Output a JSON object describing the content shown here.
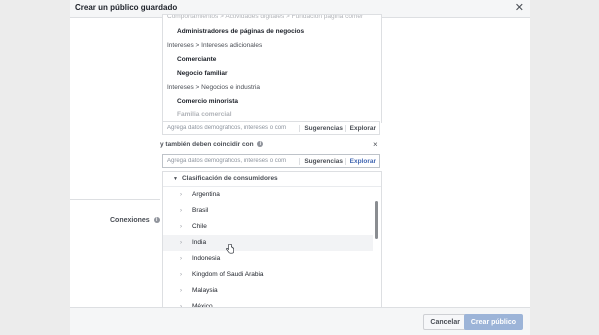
{
  "dialog": {
    "title": "Crear un público guardado",
    "close_icon": "close-icon"
  },
  "top_list": {
    "partial_top": "Comportamientos > Actividades digitales > Fundación página comer",
    "rows": [
      {
        "type": "item",
        "label": "Administradores de páginas de negocios"
      },
      {
        "type": "category",
        "label": "Intereses > Intereses adicionales"
      },
      {
        "type": "item",
        "label": "Comerciante"
      },
      {
        "type": "item",
        "label": "Negocio familiar"
      },
      {
        "type": "category",
        "label": "Intereses > Negocios e industria"
      },
      {
        "type": "item",
        "label": "Comercio minorista"
      },
      {
        "type": "item",
        "label": "Familia comercial"
      }
    ]
  },
  "search1": {
    "placeholder": "Agrega datos demográficos, intereses o com",
    "suggestions": "Sugerencias",
    "explore": "Explorar"
  },
  "also_match": {
    "label": "y también deben coincidir con",
    "close": "×"
  },
  "search2": {
    "placeholder": "Agrega datos demográficos, intereses o com",
    "suggestions": "Sugerencias",
    "explore": "Explorar"
  },
  "dropdown": {
    "header": "Clasificación de consumidores",
    "items": [
      "Argentina",
      "Brasil",
      "Chile",
      "India",
      "Indonesia",
      "Kingdom of Saudi Arabia",
      "Malaysia",
      "México"
    ],
    "hovered_index": 3
  },
  "connections": {
    "label": "Conexiones"
  },
  "footer": {
    "cancel": "Cancelar",
    "create": "Crear público"
  },
  "colors": {
    "accent": "#4267b2",
    "create_disabled": "#9cb4d8",
    "overlay": "#ececec"
  }
}
